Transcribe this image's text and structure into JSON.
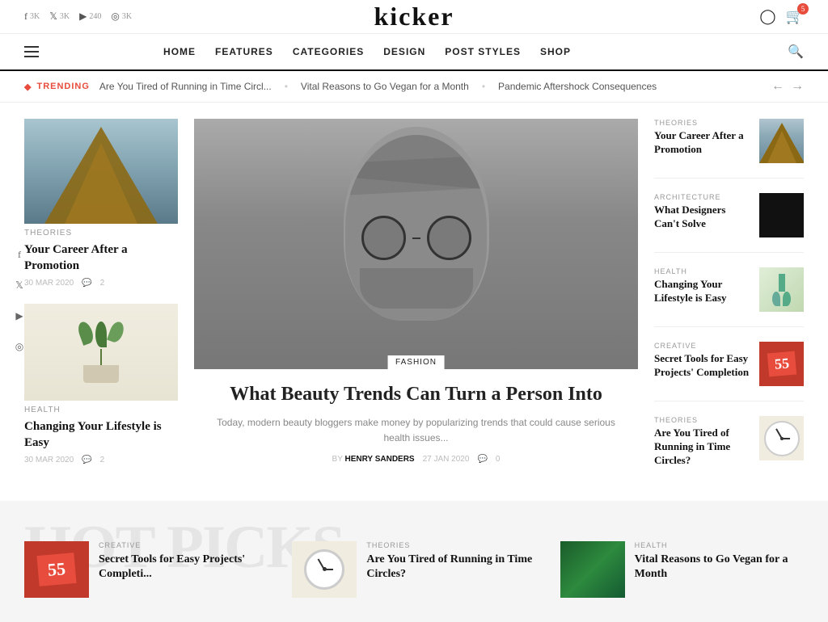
{
  "site": {
    "logo": "kicker"
  },
  "topbar": {
    "social": [
      {
        "platform": "facebook",
        "icon": "f",
        "count": "3K"
      },
      {
        "platform": "twitter",
        "icon": "t",
        "count": "3K"
      },
      {
        "platform": "youtube",
        "icon": "▶",
        "count": "240"
      },
      {
        "platform": "instagram",
        "icon": "◎",
        "count": "3K"
      }
    ]
  },
  "nav": {
    "items": [
      {
        "label": "HOME"
      },
      {
        "label": "FEATURES"
      },
      {
        "label": "CATEGORIES"
      },
      {
        "label": "DESIGN"
      },
      {
        "label": "POST STYLES"
      },
      {
        "label": "SHOP"
      }
    ]
  },
  "trending": {
    "label": "TRENDING",
    "items": [
      "Are You Tired of Running in Time Circl...",
      "Vital Reasons to Go Vegan for a Month",
      "Pandemic Aftershock Consequences"
    ]
  },
  "left_articles": [
    {
      "category": "THEORIES",
      "title": "Your Career After a Promotion",
      "date": "30 MAR 2020",
      "comments": "2"
    },
    {
      "category": "HEALTH",
      "title": "Changing Your Lifestyle is Easy",
      "date": "30 MAR 2020",
      "comments": "2"
    }
  ],
  "featured": {
    "category": "FASHION",
    "title": "What Beauty Trends Can Turn a Person Into",
    "excerpt": "Today, modern beauty bloggers make money by popularizing trends that could cause serious health issues...",
    "author": "HENRY SANDERS",
    "date": "27 JAN 2020",
    "comments": "0"
  },
  "right_articles": [
    {
      "category": "THEORIES",
      "title": "Your Career After a Promotion"
    },
    {
      "category": "ARCHITECTURE",
      "title": "What Designers Can't Solve"
    },
    {
      "category": "HEALTH",
      "title": "Changing Your Lifestyle is Easy"
    },
    {
      "category": "CREATIVE",
      "title": "Secret Tools for Easy Projects' Completion"
    },
    {
      "category": "THEORIES",
      "title": "Are You Tired of Running in Time Circles?"
    }
  ],
  "bottom_bg_text": "HOT PICKS",
  "bottom_articles": [
    {
      "category": "CREATIVE",
      "title": "Secret Tools for Easy Projects' Completi..."
    },
    {
      "category": "THEORIES",
      "title": "Are You Tired of Running in Time Circles?"
    },
    {
      "category": "HEALTH",
      "title": "Vital Reasons to Go Vegan for a Month"
    }
  ],
  "social_float": [
    "f",
    "t",
    "▶",
    "◎"
  ],
  "cart_count": "5",
  "author_by": "BY"
}
